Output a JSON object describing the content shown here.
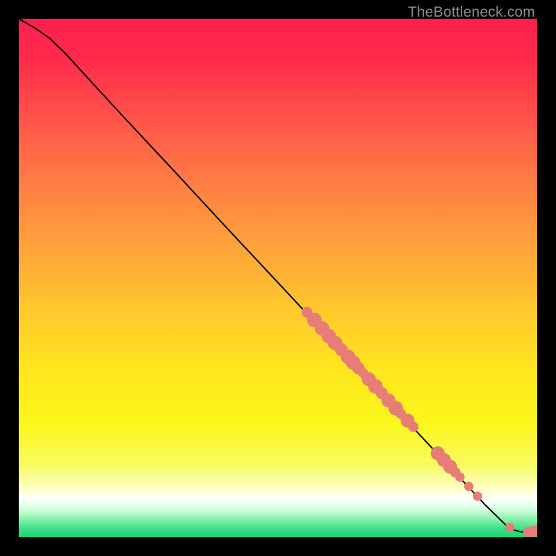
{
  "watermark": "TheBottleneck.com",
  "chart_data": {
    "type": "line",
    "title": "",
    "xlabel": "",
    "ylabel": "",
    "xlim": [
      0,
      100
    ],
    "ylim": [
      0,
      100
    ],
    "curve": [
      {
        "x": 0.0,
        "y": 100.0
      },
      {
        "x": 3.0,
        "y": 98.3
      },
      {
        "x": 6.0,
        "y": 96.2
      },
      {
        "x": 9.0,
        "y": 93.3
      },
      {
        "x": 12.0,
        "y": 90.0
      },
      {
        "x": 20.0,
        "y": 81.3
      },
      {
        "x": 30.0,
        "y": 70.6
      },
      {
        "x": 40.0,
        "y": 59.8
      },
      {
        "x": 50.0,
        "y": 49.1
      },
      {
        "x": 60.0,
        "y": 38.4
      },
      {
        "x": 70.0,
        "y": 27.6
      },
      {
        "x": 80.0,
        "y": 16.9
      },
      {
        "x": 90.0,
        "y": 6.2
      },
      {
        "x": 94.0,
        "y": 2.3
      },
      {
        "x": 95.5,
        "y": 1.4
      },
      {
        "x": 97.0,
        "y": 1.0
      },
      {
        "x": 99.0,
        "y": 1.0
      },
      {
        "x": 100.0,
        "y": 1.3
      }
    ],
    "points": [
      {
        "x": 55.6,
        "y": 43.4,
        "r": 1.05
      },
      {
        "x": 57.0,
        "y": 41.9,
        "r": 1.4
      },
      {
        "x": 58.5,
        "y": 40.3,
        "r": 1.4
      },
      {
        "x": 59.8,
        "y": 38.8,
        "r": 1.4
      },
      {
        "x": 61.0,
        "y": 37.5,
        "r": 1.4
      },
      {
        "x": 62.2,
        "y": 36.2,
        "r": 1.25
      },
      {
        "x": 63.5,
        "y": 34.8,
        "r": 1.4
      },
      {
        "x": 64.5,
        "y": 33.7,
        "r": 1.4
      },
      {
        "x": 65.5,
        "y": 32.6,
        "r": 1.2
      },
      {
        "x": 66.4,
        "y": 31.7,
        "r": 0.95
      },
      {
        "x": 67.5,
        "y": 30.5,
        "r": 1.35
      },
      {
        "x": 68.8,
        "y": 29.1,
        "r": 1.4
      },
      {
        "x": 70.0,
        "y": 27.8,
        "r": 1.15
      },
      {
        "x": 71.3,
        "y": 26.4,
        "r": 1.35
      },
      {
        "x": 72.7,
        "y": 24.9,
        "r": 1.4
      },
      {
        "x": 73.7,
        "y": 23.8,
        "r": 1.0
      },
      {
        "x": 75.0,
        "y": 22.5,
        "r": 1.35
      },
      {
        "x": 76.1,
        "y": 21.3,
        "r": 1.0
      },
      {
        "x": 80.8,
        "y": 16.2,
        "r": 1.35
      },
      {
        "x": 82.0,
        "y": 14.9,
        "r": 1.35
      },
      {
        "x": 83.2,
        "y": 13.6,
        "r": 1.35
      },
      {
        "x": 84.2,
        "y": 12.5,
        "r": 1.0
      },
      {
        "x": 85.1,
        "y": 11.6,
        "r": 0.9
      },
      {
        "x": 86.8,
        "y": 9.8,
        "r": 0.9
      },
      {
        "x": 88.5,
        "y": 7.9,
        "r": 0.9
      },
      {
        "x": 94.7,
        "y": 1.9,
        "r": 0.9
      },
      {
        "x": 98.4,
        "y": 1.0,
        "r": 1.1
      },
      {
        "x": 99.6,
        "y": 1.2,
        "r": 1.1
      }
    ],
    "gradient_stops": [
      {
        "offset": 0.0,
        "color": "#ff1f4e"
      },
      {
        "offset": 0.08,
        "color": "#ff2b4b"
      },
      {
        "offset": 0.2,
        "color": "#ff564a"
      },
      {
        "offset": 0.32,
        "color": "#ff7e44"
      },
      {
        "offset": 0.44,
        "color": "#ffa33a"
      },
      {
        "offset": 0.56,
        "color": "#ffc82d"
      },
      {
        "offset": 0.68,
        "color": "#ffe61e"
      },
      {
        "offset": 0.78,
        "color": "#fbf71b"
      },
      {
        "offset": 0.86,
        "color": "#f7fb60"
      },
      {
        "offset": 0.905,
        "color": "#fdffc2"
      },
      {
        "offset": 0.925,
        "color": "#ffffff"
      },
      {
        "offset": 0.945,
        "color": "#d7ffe1"
      },
      {
        "offset": 0.965,
        "color": "#8af2ac"
      },
      {
        "offset": 0.985,
        "color": "#36df87"
      },
      {
        "offset": 1.0,
        "color": "#18d477"
      }
    ],
    "point_color": "#e67d77",
    "curve_color": "#000000"
  }
}
